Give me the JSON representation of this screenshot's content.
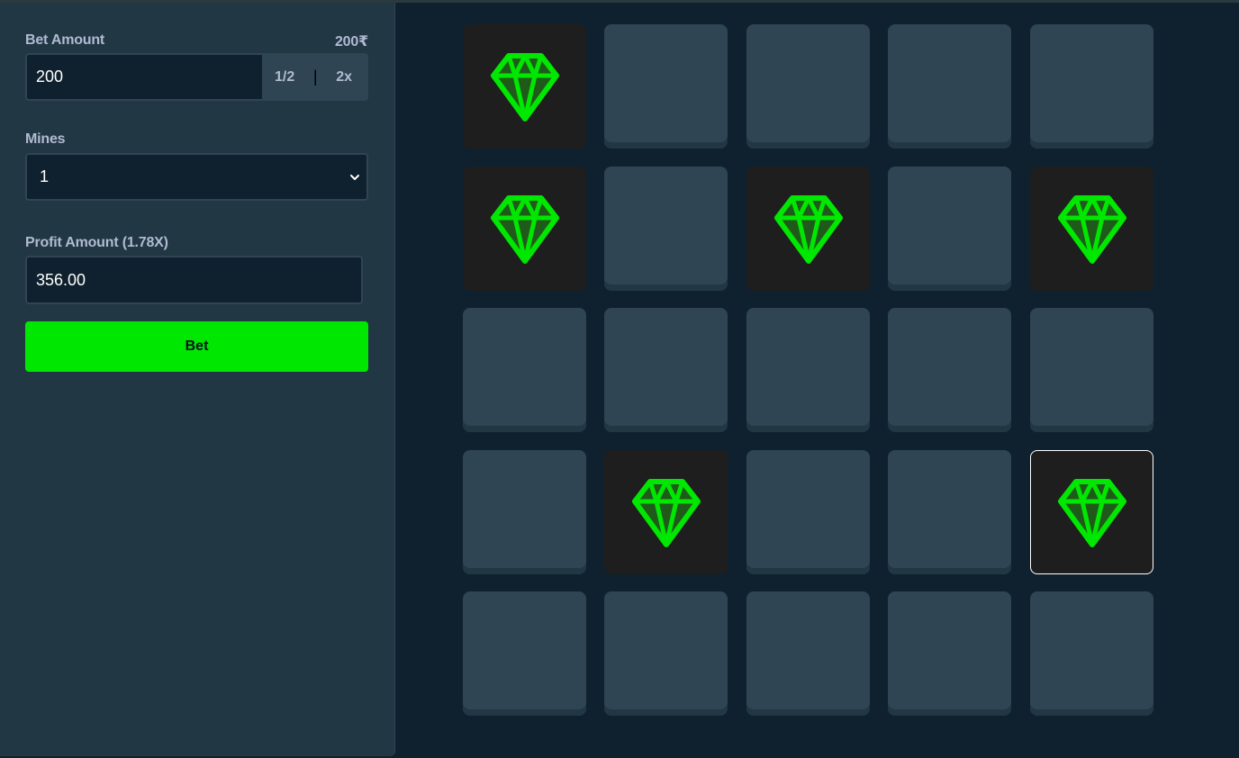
{
  "bet": {
    "label": "Bet Amount",
    "balance": "200₹",
    "value": "200",
    "half_label": "1/2",
    "separator": "|",
    "double_label": "2x"
  },
  "mines": {
    "label": "Mines",
    "selected": "1"
  },
  "profit": {
    "label": "Profit Amount (1.78X)",
    "value": "356.00"
  },
  "bet_button": {
    "label": "Bet"
  },
  "colors": {
    "gem": "#00e701",
    "tile_hidden": "#2f4553",
    "tile_revealed": "#1e1e1e",
    "bet_button": "#00e701"
  },
  "board": {
    "rows": 5,
    "cols": 5,
    "tiles": [
      [
        "gem",
        "hidden",
        "hidden",
        "hidden",
        "hidden"
      ],
      [
        "gem",
        "hidden",
        "gem",
        "hidden",
        "gem"
      ],
      [
        "hidden",
        "hidden",
        "hidden",
        "hidden",
        "hidden"
      ],
      [
        "hidden",
        "gem",
        "hidden",
        "hidden",
        "gem-selected"
      ],
      [
        "hidden",
        "hidden",
        "hidden",
        "hidden",
        "hidden"
      ]
    ],
    "icon": "gem-icon"
  }
}
